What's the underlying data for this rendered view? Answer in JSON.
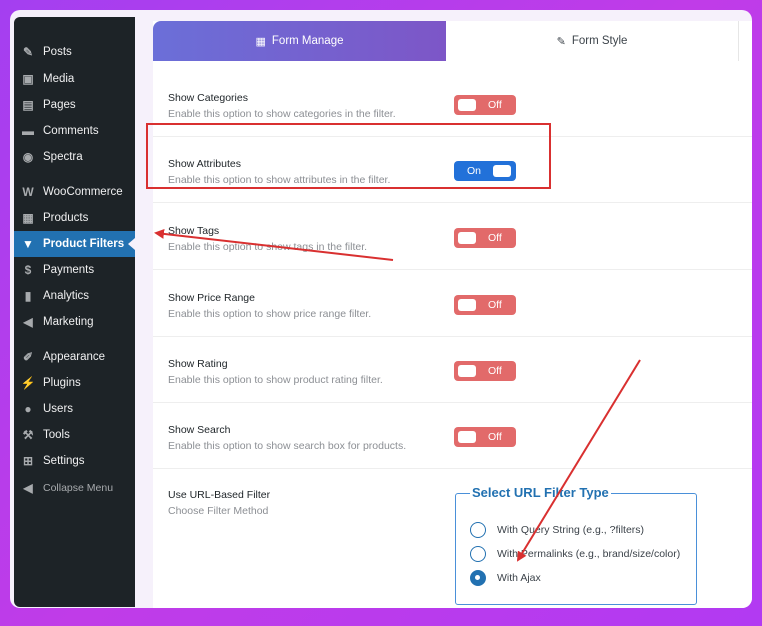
{
  "sidebar": {
    "items": [
      {
        "label": "Posts",
        "icon": "pin-icon",
        "glyph": "✎"
      },
      {
        "label": "Media",
        "icon": "media-icon",
        "glyph": "▣"
      },
      {
        "label": "Pages",
        "icon": "pages-icon",
        "glyph": "▤"
      },
      {
        "label": "Comments",
        "icon": "comments-icon",
        "glyph": "▬"
      },
      {
        "label": "Spectra",
        "icon": "spectra-icon",
        "glyph": "◉"
      },
      {
        "label": "WooCommerce",
        "icon": "woocommerce-icon",
        "glyph": "W"
      },
      {
        "label": "Products",
        "icon": "products-icon",
        "glyph": "▦"
      },
      {
        "label": "Product Filters",
        "icon": "filter-icon",
        "glyph": "▼"
      },
      {
        "label": "Payments",
        "icon": "payments-icon",
        "glyph": "$"
      },
      {
        "label": "Analytics",
        "icon": "analytics-icon",
        "glyph": "▮"
      },
      {
        "label": "Marketing",
        "icon": "marketing-icon",
        "glyph": "◀"
      },
      {
        "label": "Appearance",
        "icon": "appearance-icon",
        "glyph": "✐"
      },
      {
        "label": "Plugins",
        "icon": "plugins-icon",
        "glyph": "⚡"
      },
      {
        "label": "Users",
        "icon": "users-icon",
        "glyph": "●"
      },
      {
        "label": "Tools",
        "icon": "tools-icon",
        "glyph": "⚒"
      },
      {
        "label": "Settings",
        "icon": "settings-icon",
        "glyph": "⊞"
      },
      {
        "label": "Collapse Menu",
        "icon": "collapse-icon",
        "glyph": "◀"
      }
    ],
    "active": "Product Filters",
    "colors": {
      "background": "#1d2327",
      "active": "#2271b1"
    }
  },
  "tabs": [
    {
      "label": "Form Manage",
      "icon": "form-icon",
      "glyph": "▦"
    },
    {
      "label": "Form Style",
      "icon": "brush-icon",
      "glyph": "✎"
    }
  ],
  "options": [
    {
      "title": "Show Categories",
      "desc": "Enable this option to show categories in the filter.",
      "state": "Off"
    },
    {
      "title": "Show Attributes",
      "desc": "Enable this option to show attributes in the filter.",
      "state": "On"
    },
    {
      "title": "Show Tags",
      "desc": "Enable this option to show tags in the filter.",
      "state": "Off"
    },
    {
      "title": "Show Price Range",
      "desc": "Enable this option to show price range filter.",
      "state": "Off"
    },
    {
      "title": "Show Rating",
      "desc": "Enable this option to show product rating filter.",
      "state": "Off"
    },
    {
      "title": "Show Search",
      "desc": "Enable this option to show search box for products.",
      "state": "Off"
    }
  ],
  "url_filter": {
    "title": "Use URL-Based Filter",
    "desc": "Choose Filter Method",
    "legend": "Select URL Filter Type",
    "options": [
      {
        "label": "With Query String (e.g., ?filters)",
        "checked": false
      },
      {
        "label": "With Permalinks (e.g., brand/size/color)",
        "checked": false
      },
      {
        "label": "With Ajax",
        "checked": true
      }
    ]
  },
  "colors": {
    "toggle_off": "#e26a6a",
    "toggle_on": "#2271d9",
    "annotation": "#d93030",
    "accent": "#2271b1"
  }
}
